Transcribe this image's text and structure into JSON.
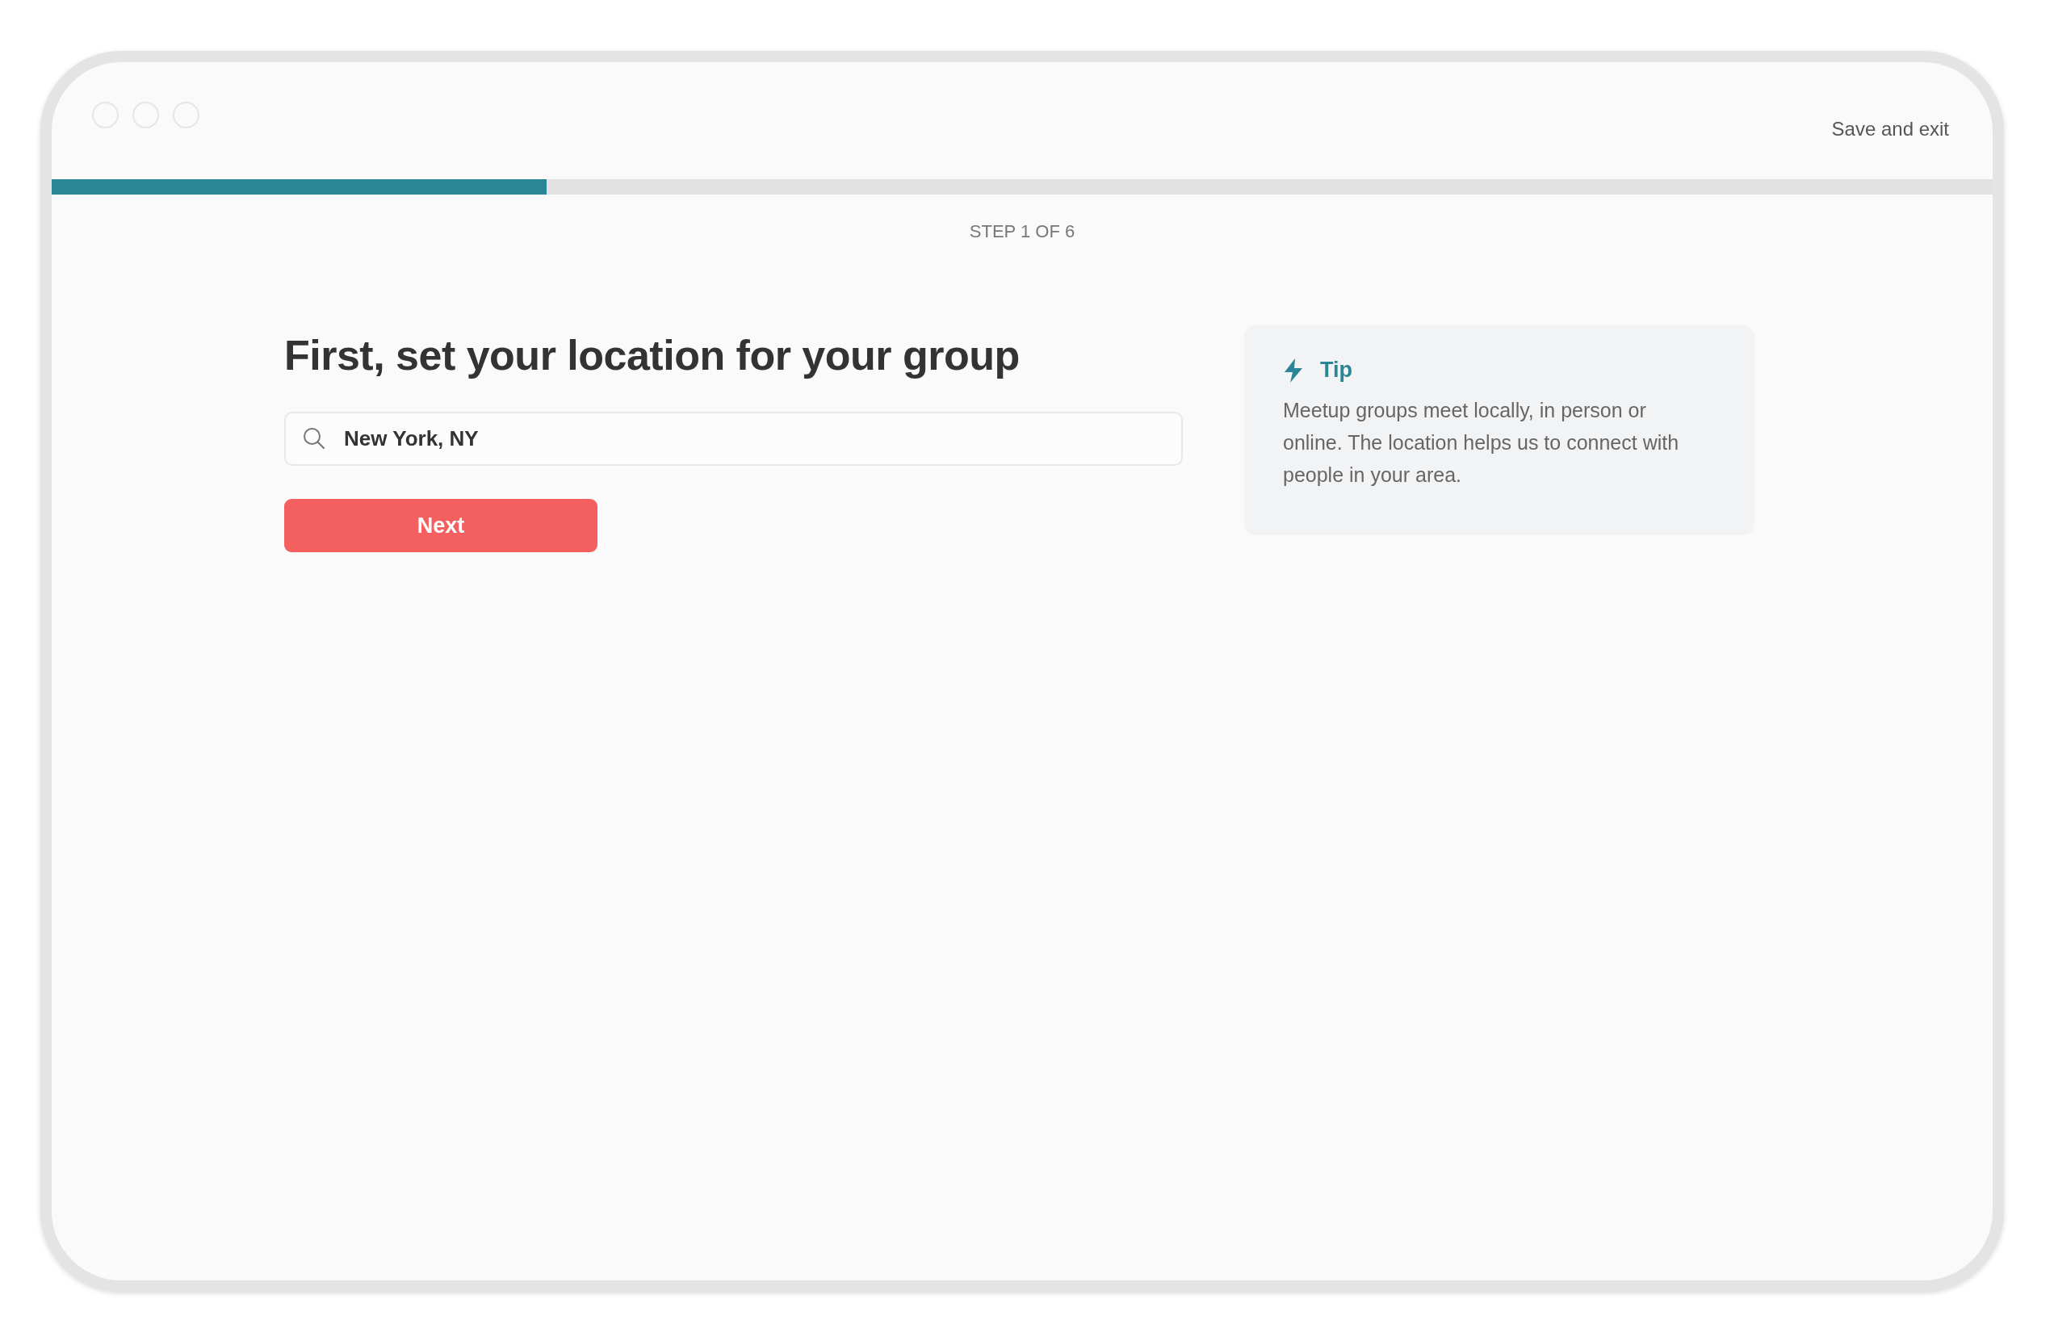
{
  "header": {
    "save_exit": "Save and exit"
  },
  "progress": {
    "level": 0.255,
    "step_label": "STEP 1 OF 6"
  },
  "form": {
    "title": "First, set your location for your group",
    "location": {
      "value": "New York, NY"
    },
    "next_button": "Next"
  },
  "tip": {
    "title": "Tip",
    "body": "Meetup groups meet locally, in person or online. The location helps us to connect with people in your area."
  }
}
